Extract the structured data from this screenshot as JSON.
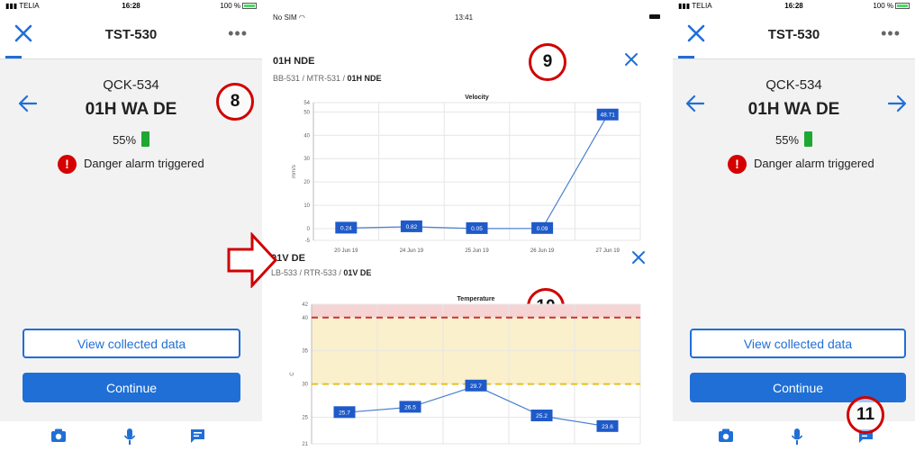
{
  "left_screen": {
    "status": {
      "carrier": "TELIA",
      "time": "16:28",
      "battery": "100 %"
    },
    "nav": {
      "title": "TST-530"
    },
    "subtitle": "QCK-534",
    "machine": "01H WA DE",
    "battery": "55%",
    "alarm": "Danger alarm triggered",
    "view_button": "View collected data",
    "continue_button": "Continue",
    "callout": "8"
  },
  "right_screen": {
    "status": {
      "carrier": "TELIA",
      "time": "16:28",
      "battery": "100 %"
    },
    "nav": {
      "title": "TST-530"
    },
    "subtitle": "QCK-534",
    "machine": "01H WA DE",
    "battery": "55%",
    "alarm": "Danger alarm triggered",
    "view_button": "View collected data",
    "continue_button": "Continue",
    "callout": "11"
  },
  "middle_screen": {
    "status": {
      "carrier": "No SIM",
      "time": "13:41"
    },
    "panel1": {
      "title": "01H NDE",
      "path_prefix": "BB-531 / MTR-531 / ",
      "path_last": "01H NDE",
      "callout": "9"
    },
    "panel2": {
      "title": "01V DE",
      "path_prefix": "LB-533 / RTR-533 / ",
      "path_last": "01V DE",
      "callout": "10"
    }
  },
  "chart_data": [
    {
      "type": "line",
      "title": "Velocity",
      "ylabel": "mm/s",
      "categories": [
        "20 Jun 19",
        "24 Jun 19",
        "25 Jun 19",
        "26 Jun 19",
        "27 Jun 19"
      ],
      "values": [
        0.24,
        0.82,
        0.05,
        0.09,
        48.71
      ],
      "ylim": [
        -5,
        54
      ],
      "yticks": [
        -5,
        0,
        10,
        20,
        30,
        40,
        50,
        54
      ],
      "grid": true
    },
    {
      "type": "line",
      "title": "Temperature",
      "ylabel": "C",
      "categories": [
        "",
        "",
        "",
        "",
        ""
      ],
      "values": [
        25.7,
        26.5,
        29.7,
        25.2,
        23.6
      ],
      "ylim": [
        21,
        42
      ],
      "yticks": [
        21,
        25,
        30,
        35,
        40,
        42
      ],
      "alarm_danger": 40,
      "alarm_warning": 30,
      "colors": {
        "line": "#4a7fd0",
        "danger": "#d23030",
        "warning": "#e8c020",
        "danger_zone": "#f6d4d4",
        "warning_zone": "#fbf0cc"
      },
      "grid": true
    }
  ]
}
